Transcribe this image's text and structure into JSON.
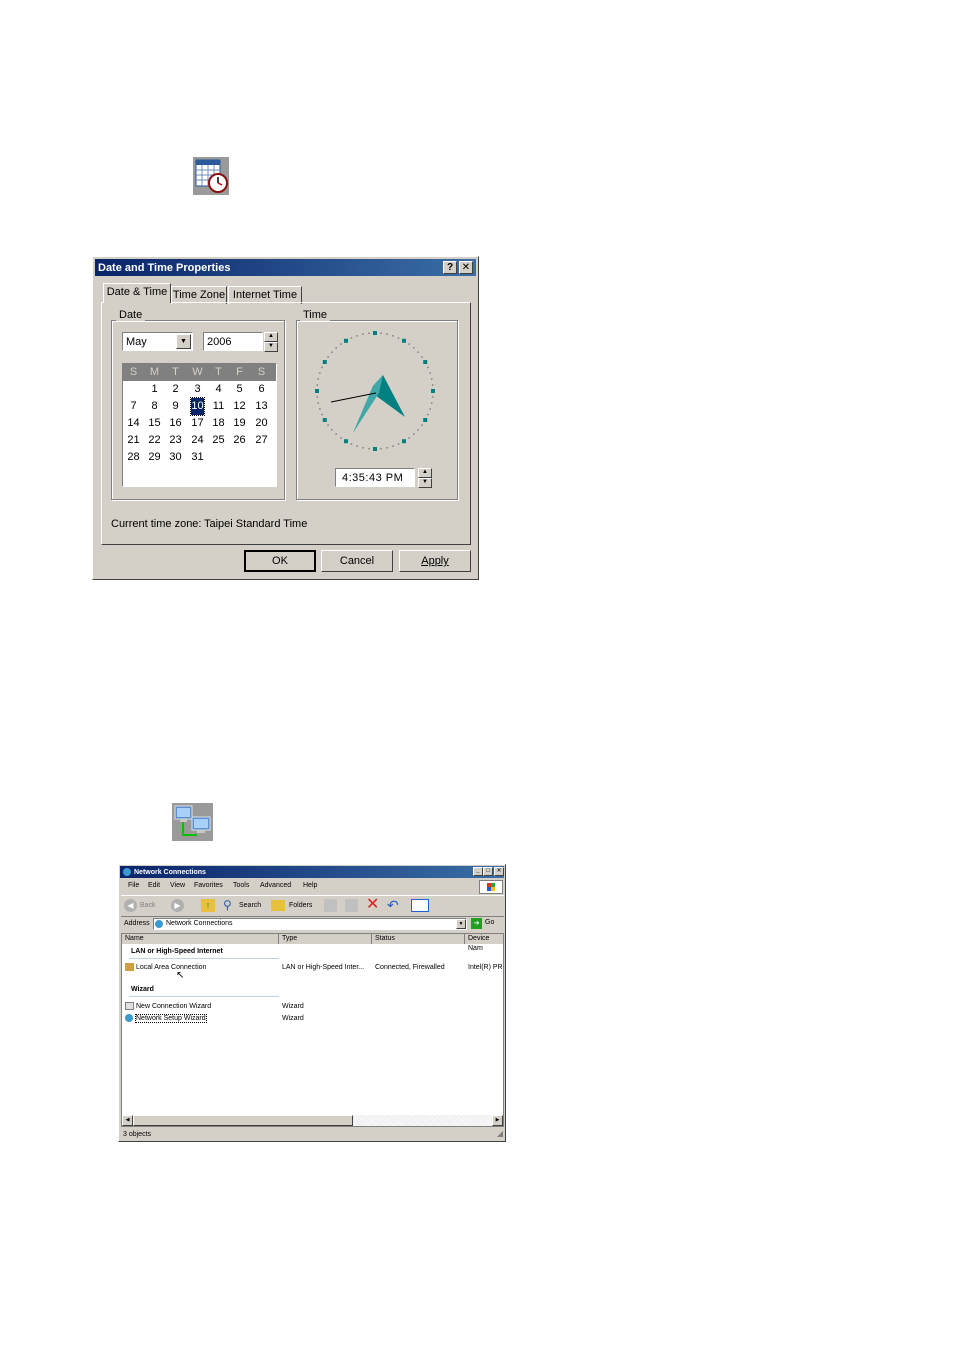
{
  "datetime": {
    "title": "Date and Time Properties",
    "help_btn": "?",
    "close_btn": "✕",
    "tabs": [
      "Date & Time",
      "Time Zone",
      "Internet Time"
    ],
    "date_group": "Date",
    "time_group": "Time",
    "month": "May",
    "year": "2006",
    "weekdays": [
      "S",
      "M",
      "T",
      "W",
      "T",
      "F",
      "S"
    ],
    "weeks": [
      [
        "",
        "1",
        "2",
        "3",
        "4",
        "5",
        "6"
      ],
      [
        "7",
        "8",
        "9",
        "10",
        "11",
        "12",
        "13"
      ],
      [
        "14",
        "15",
        "16",
        "17",
        "18",
        "19",
        "20"
      ],
      [
        "21",
        "22",
        "23",
        "24",
        "25",
        "26",
        "27"
      ],
      [
        "28",
        "29",
        "30",
        "31",
        "",
        "",
        ""
      ]
    ],
    "selected_day": "10",
    "time_value": "4:35:43 PM",
    "timezone_label": "Current time zone:",
    "timezone_value": "Taipei Standard Time",
    "ok": "OK",
    "cancel": "Cancel",
    "apply": "Apply",
    "clock_color": "#008080"
  },
  "netconn": {
    "title": "Network Connections",
    "menu": [
      "File",
      "Edit",
      "View",
      "Favorites",
      "Tools",
      "Advanced",
      "Help"
    ],
    "toolbar": {
      "back": "Back",
      "search": "Search",
      "folders": "Folders"
    },
    "address_label": "Address",
    "address_value": "Network Connections",
    "go": "Go",
    "columns": [
      "Name",
      "Type",
      "Status",
      "Device Nam"
    ],
    "group1": "LAN or High-Speed Internet",
    "row1": {
      "name": "Local Area Connection",
      "type": "LAN or High-Speed Inter...",
      "status": "Connected, Firewalled",
      "device": "Intel(R) PR"
    },
    "group2": "Wizard",
    "row2": {
      "name": "New Connection Wizard",
      "type": "Wizard"
    },
    "row3": {
      "name": "Network Setup Wizard",
      "type": "Wizard"
    },
    "status": "3 objects",
    "title_color": "#0a246a"
  }
}
